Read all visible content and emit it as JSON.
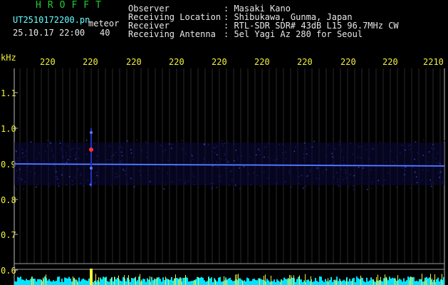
{
  "header": {
    "brand": "HROFFT",
    "filename": "UT2510172200.pn",
    "mode": "meteor",
    "timestamp": "25.10.17 22:00",
    "count": "40",
    "info_labels": [
      "Observer",
      "Receiving Location",
      "Receiver",
      "Receiving Antenna"
    ],
    "info_values": [
      ": Masaki Kano",
      ": Shibukawa, Gunma, Japan",
      ": RTL-SDR SDR# 43dB L15 96.7MHz CW",
      ": 5el Yagi Az 280 for Seoul"
    ]
  },
  "time_axis": {
    "ticks": [
      "220",
      "220",
      "220",
      "220",
      "220",
      "220",
      "220",
      "220",
      "220",
      "2210"
    ]
  },
  "freq_axis": {
    "unit": "kHz",
    "ticks": [
      "1.1",
      "1.0",
      "0.9",
      "0.8",
      "0.7",
      "0.6"
    ]
  },
  "colors": {
    "brand": "#22cc33",
    "filename": "#66ffff",
    "labels": "#e8e8e8",
    "ticks": "#f2f23a",
    "trace": "#3a5cff",
    "baseline": "#00e5ff",
    "echo": "#ff3333"
  }
}
